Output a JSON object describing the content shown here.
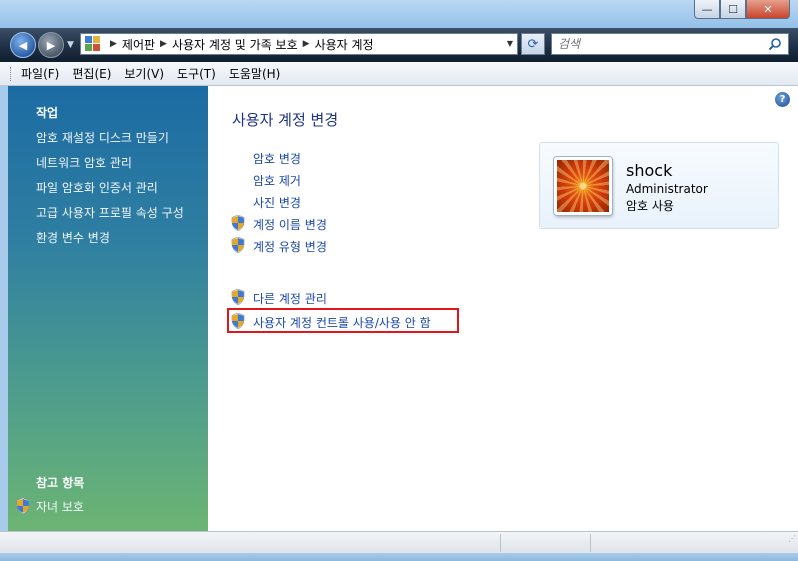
{
  "window": {
    "minimize_label": "—",
    "maximize_label": "☐",
    "close_label": "✕"
  },
  "navigation": {
    "back_label": "◀",
    "forward_label": "▶",
    "breadcrumbs": [
      "제어판",
      "사용자 계정 및 가족 보호",
      "사용자 계정"
    ],
    "search_placeholder": "검색"
  },
  "menu": [
    "파일(F)",
    "편집(E)",
    "보기(V)",
    "도구(T)",
    "도움말(H)"
  ],
  "sidebar": {
    "tasks_heading": "작업",
    "tasks": [
      "암호 재설정 디스크 만들기",
      "네트워크 암호 관리",
      "파일 암호화 인증서 관리",
      "고급 사용자 프로필 속성 구성",
      "환경 변수 변경"
    ],
    "see_also_heading": "참고 항목",
    "see_also": [
      "자녀 보호"
    ]
  },
  "main": {
    "title": "사용자 계정 변경",
    "tasks": [
      {
        "label": "암호 변경",
        "shield": false
      },
      {
        "label": "암호 제거",
        "shield": false
      },
      {
        "label": "사진 변경",
        "shield": false
      },
      {
        "label": "계정 이름 변경",
        "shield": true
      },
      {
        "label": "계정 유형 변경",
        "shield": true
      }
    ],
    "other_tasks": [
      {
        "label": "다른 계정 관리",
        "shield": true
      },
      {
        "label": "사용자 계정 컨트롤 사용/사용 안 함",
        "shield": true,
        "highlighted": true
      }
    ],
    "help_label": "?"
  },
  "account": {
    "name": "shock",
    "type": "Administrator",
    "password_status": "암호 사용"
  },
  "colors": {
    "link": "#1b49a6",
    "title": "#1e3287",
    "highlight_border": "#e0161b"
  }
}
